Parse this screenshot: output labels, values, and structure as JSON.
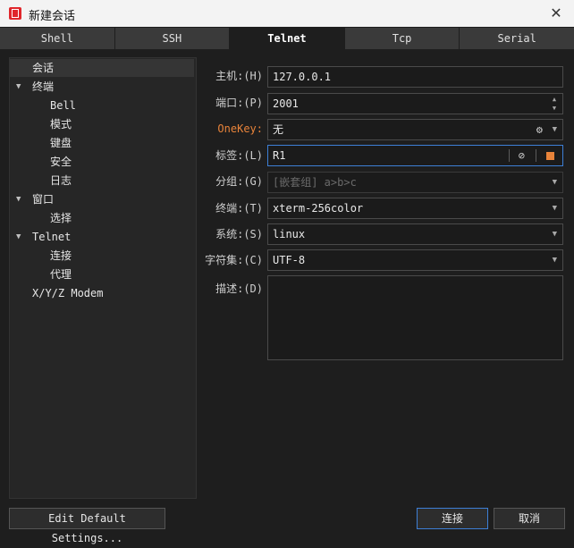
{
  "window": {
    "title": "新建会话",
    "close_glyph": "✕"
  },
  "tabs": [
    {
      "label": "Shell"
    },
    {
      "label": "SSH"
    },
    {
      "label": "Telnet",
      "active": true
    },
    {
      "label": "Tcp"
    },
    {
      "label": "Serial"
    }
  ],
  "tree": {
    "items": [
      {
        "label": "会话"
      },
      {
        "label": "终端"
      },
      {
        "label": "Bell"
      },
      {
        "label": "模式"
      },
      {
        "label": "键盘"
      },
      {
        "label": "安全"
      },
      {
        "label": "日志"
      },
      {
        "label": "窗口"
      },
      {
        "label": "选择"
      },
      {
        "label": "Telnet"
      },
      {
        "label": "连接"
      },
      {
        "label": "代理"
      },
      {
        "label": "X/Y/Z Modem"
      }
    ]
  },
  "form": {
    "host": {
      "label": "主机:(H)",
      "value": "127.0.0.1"
    },
    "port": {
      "label": "端口:(P)",
      "value": "2001"
    },
    "onekey": {
      "label": "OneKey:",
      "value": "无"
    },
    "tag": {
      "label": "标签:(L)",
      "value": "R1"
    },
    "group": {
      "label": "分组:(G)",
      "placeholder": "[嵌套组] a>b>c"
    },
    "terminal": {
      "label": "终端:(T)",
      "value": "xterm-256color"
    },
    "system": {
      "label": "系统:(S)",
      "value": "linux"
    },
    "charset": {
      "label": "字符集:(C)",
      "value": "UTF-8"
    },
    "description": {
      "label": "描述:(D)",
      "value": ""
    }
  },
  "buttons": {
    "edit_defaults": "Edit Default Settings...",
    "connect": "连接",
    "cancel": "取消"
  },
  "colors": {
    "accent": "#e8833a",
    "focus": "#3d7fd6",
    "background": "#1e1e1e"
  }
}
